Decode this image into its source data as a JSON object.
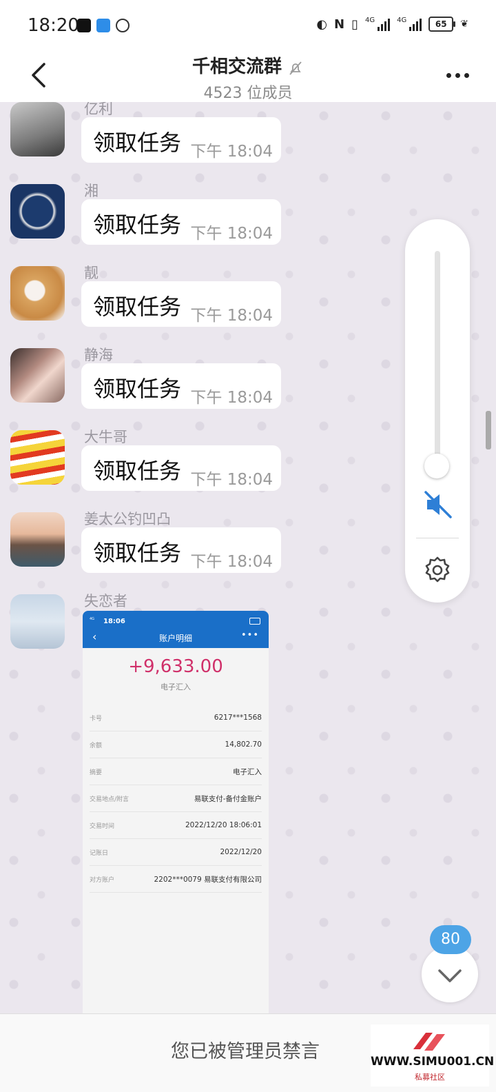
{
  "status_bar": {
    "time": "18:20",
    "network_1": "4G",
    "network_2": "4G",
    "battery": "65"
  },
  "header": {
    "title": "千相交流群",
    "subtitle": "4523 位成员"
  },
  "messages": [
    {
      "sender": "亿利",
      "text": "领取任务",
      "time": "下午 18:04"
    },
    {
      "sender": "湘",
      "text": "领取任务",
      "time": "下午 18:04"
    },
    {
      "sender": "靓",
      "text": "领取任务",
      "time": "下午 18:04"
    },
    {
      "sender": "静海",
      "text": "领取任务",
      "time": "下午 18:04"
    },
    {
      "sender": "大牛哥",
      "text": "领取任务",
      "time": "下午 18:04"
    },
    {
      "sender": "姜太公钓凹凸",
      "text": "领取任务",
      "time": "下午 18:04"
    }
  ],
  "image_message": {
    "sender": "失恋者",
    "screenshot": {
      "time": "18:06",
      "net": "4G",
      "title": "账户明细",
      "amount": "+9,633.00",
      "type": "电子汇入",
      "rows": [
        {
          "k": "卡号",
          "v": "6217***1568"
        },
        {
          "k": "余额",
          "v": "14,802.70"
        },
        {
          "k": "摘要",
          "v": "电子汇入"
        },
        {
          "k": "交易地点/附言",
          "v": "易联支付-备付金账户"
        },
        {
          "k": "交易时间",
          "v": "2022/12/20 18:06:01"
        },
        {
          "k": "记账日",
          "v": "2022/12/20"
        },
        {
          "k": "对方账户",
          "v": "2202***0079 易联支付有限公司"
        }
      ]
    }
  },
  "volume_panel": {
    "level": 0.0,
    "muted": true
  },
  "unread_count": "80",
  "bottom": {
    "banned_text": "您已被管理员禁言"
  },
  "watermark": {
    "url": "WWW.SIMU001.CN",
    "sub": "私募社区"
  },
  "colors": {
    "accent": "#1a6fc8",
    "unread_badge": "#4da4e6",
    "amount": "#d0306a",
    "mute_icon": "#2e7fd6"
  }
}
